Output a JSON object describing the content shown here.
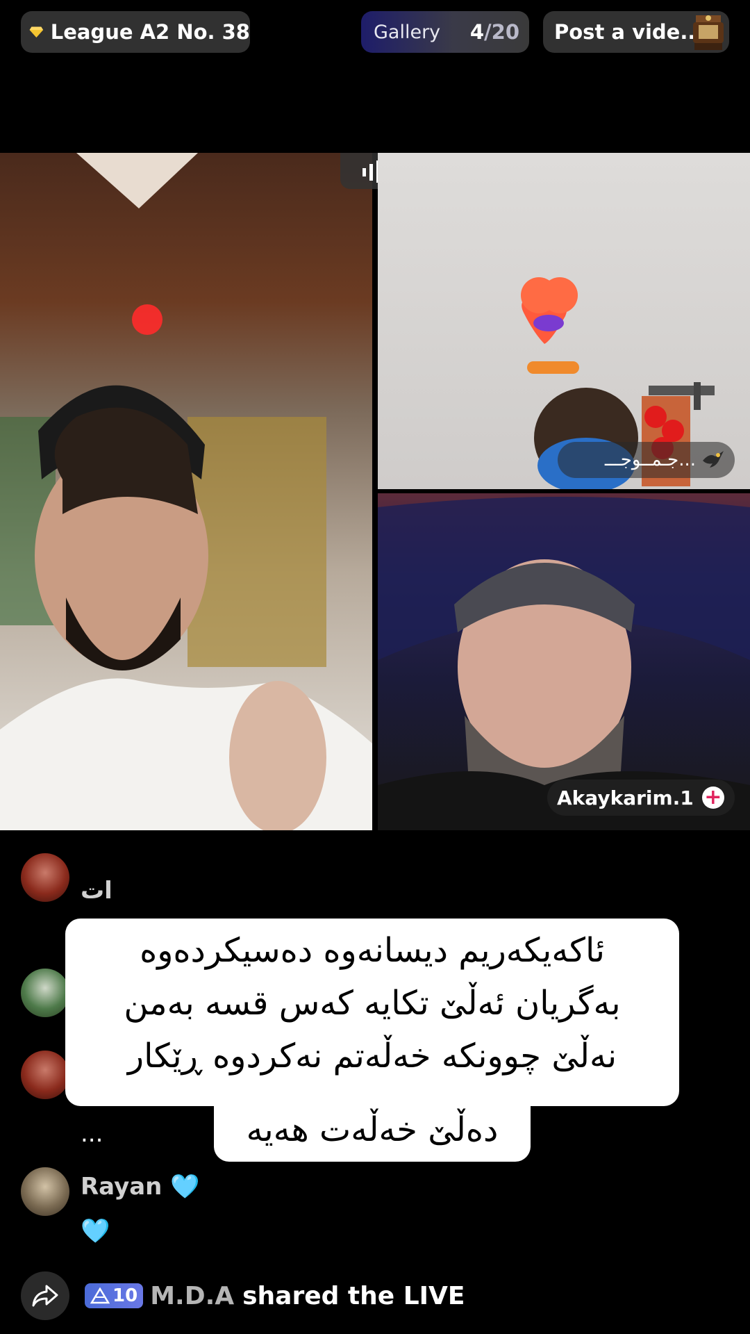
{
  "top_bar": {
    "league_label": "League A2 No. 38",
    "gallery_label": "Gallery",
    "gallery_count_current": "4",
    "gallery_count_total": "/20",
    "post_video_label": "Post a vide..."
  },
  "video_grid": {
    "top_right_user": "جـمــوجـــ...",
    "bottom_right_user": "Akaykarim.1"
  },
  "chat": {
    "items": [
      {
        "name": "ات",
        "text": ""
      },
      {
        "name": "",
        "text": ""
      },
      {
        "name": "",
        "text": ""
      },
      {
        "name": "",
        "text": "..."
      },
      {
        "name": "Rayan 🩵",
        "text": "🩵"
      }
    ]
  },
  "caption": {
    "lines": [
      "ئاکەیکەریم دیسانەوە دەسیکردەوە",
      "بەگریان ئەڵێ تکایە کەس قسە بەمن",
      "نەڵێ چوونکە خەڵەتم نەکردوە ڕێکار",
      "دەڵێ خەڵەت هەیە"
    ]
  },
  "share": {
    "level": "10",
    "user": "M.D.A",
    "text": "shared the LIVE"
  },
  "colors": {
    "accent_plus": "#e0245e",
    "level_badge": "#5a6fe0",
    "diamond": "#f4c430"
  }
}
